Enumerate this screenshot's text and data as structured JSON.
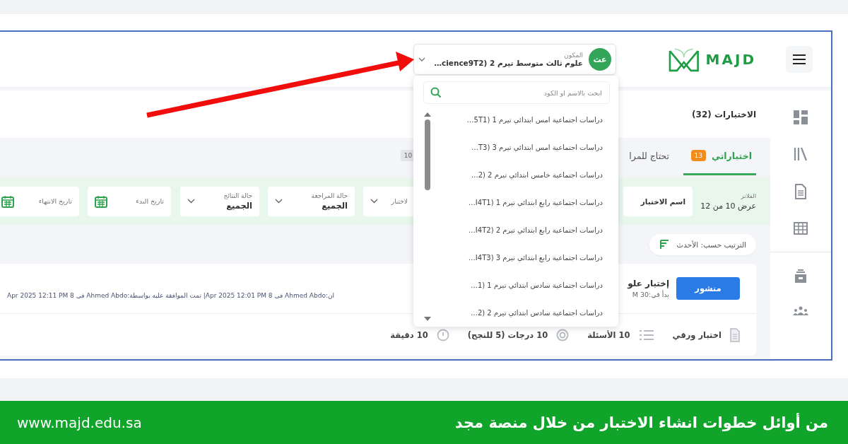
{
  "header": {
    "logo": "MAJD",
    "selector": {
      "avatar": "عث",
      "label": "المكون",
      "value": "علوم ثالث متوسط تيرم 2 (cience9T2…",
      "expanded": true
    }
  },
  "dropdown": {
    "search": {
      "placeholder": "ابحث بالاسم او الكود"
    },
    "items": [
      {
        "label": "دراسات اجتماعية امس ابتدائي تيرم 1 (5T1…"
      },
      {
        "label": "دراسات اجتماعية امس ابتدائي تيرم 3 (T3…"
      },
      {
        "label": "دراسات اجتماعية خامس ابتدائي تيرم 2 (2…"
      },
      {
        "label": "دراسات اجتماعية رابع ابتدائي تيرم 1 (I4T1…"
      },
      {
        "label": "دراسات اجتماعية رابع ابتدائي تيرم 2 (I4T2…"
      },
      {
        "label": "دراسات اجتماعية رابع ابتدائي تيرم 3 (I4T3…"
      },
      {
        "label": "دراسات اجتماعية سادس ابتدائي تيرم 1 (1…"
      },
      {
        "label": "دراسات اجتماعية سادس ابتدائي تيرم 2 (2…"
      }
    ]
  },
  "page_title": "الاختبارات (32)",
  "tabs": [
    {
      "label": "اختباراتي",
      "count": "13",
      "selected": true
    },
    {
      "label": "تحتاج للمرا",
      "selected": false
    },
    {
      "count": "10",
      "selected": false
    }
  ],
  "filters": {
    "label": "الفلاتر",
    "summary": "عرض 10 من 12",
    "fields": [
      {
        "kind": "text",
        "value": "اسم الاختبار"
      },
      {
        "kind": "select",
        "label": "لاختبار"
      },
      {
        "kind": "select",
        "label": "حالة المراجعة",
        "value": "الجميع"
      },
      {
        "kind": "select",
        "label": "حالة النتائج",
        "value": "الجميع"
      },
      {
        "kind": "date",
        "placeholder": "تاريخ البدء"
      },
      {
        "kind": "date",
        "placeholder": "تاريخ الانتهاء"
      }
    ]
  },
  "sort": "الترتيب حسب: الأحدث",
  "card": {
    "status": "منشور",
    "title": "إختبار علو",
    "subtitle": "بدأ في:30 M",
    "meta": "ان:Ahmed Abdo فى 8 Apr 2025 12:01 PM| تمت الموافقة عليه بواسطة:Ahmed Abdo فى 8 Apr 2025 12:11 PM",
    "details": [
      {
        "kind": "type",
        "text": "اختبار ورقي"
      },
      {
        "kind": "questions",
        "text": "10 الأسئلة"
      },
      {
        "kind": "grades",
        "text": "10 درجات (5 للنجح)"
      },
      {
        "kind": "duration",
        "text": "10 دقيقة"
      }
    ]
  },
  "banner": {
    "headline": "من أوائل خطوات انشاء الاختبار من خلال منصة مجد",
    "url": "www.majd.edu.sa"
  }
}
